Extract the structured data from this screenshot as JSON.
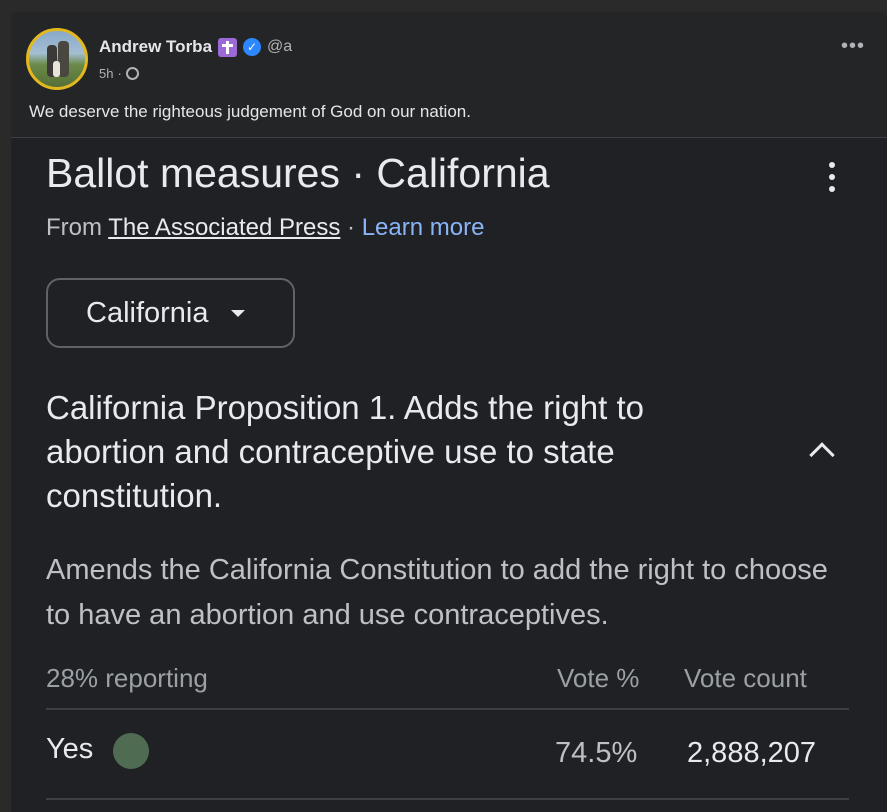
{
  "post": {
    "author_name": "Andrew Torba",
    "handle": "@a",
    "time": "5h",
    "separator": "·",
    "more_label": "•••",
    "text": "We deserve the righteous judgement of God on our nation."
  },
  "embed": {
    "title": "Ballot measures · California",
    "source_prefix": "From ",
    "source_name": "The Associated Press",
    "source_sep": " · ",
    "learn_more": "Learn more",
    "dropdown_value": "California",
    "proposition_title": "California Proposition 1. Adds the right to abortion and contraceptive use to state constitution.",
    "description": "Amends the California Constitution to add the right to choose to have an abortion and use contraceptives.",
    "table": {
      "reporting": "28% reporting",
      "col_vote_pct": "Vote %",
      "col_vote_count": "Vote count",
      "rows": [
        {
          "choice": "Yes",
          "vote_pct": "74.5%",
          "vote_count": "2,888,207",
          "color": "#4f6b52"
        }
      ]
    }
  },
  "colors": {
    "post_bg": "#242526",
    "embed_bg": "#202124",
    "link": "#8ab4f8",
    "avatar_ring": "#e3b81e",
    "verified": "#2d88ff",
    "badge": "#9b6ad6"
  }
}
